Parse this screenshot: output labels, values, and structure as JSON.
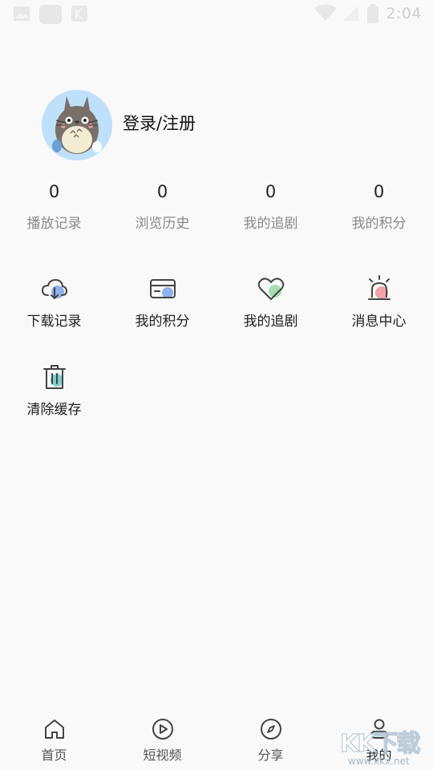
{
  "status_bar": {
    "time": "2:04",
    "icons": [
      "image-icon",
      "notification-icon",
      "app-icon",
      "wifi-icon",
      "signal-icon",
      "battery-icon"
    ]
  },
  "profile": {
    "avatar_icon": "totoro-avatar",
    "login_text": "登录/注册"
  },
  "stats": [
    {
      "value": "0",
      "label": "播放记录"
    },
    {
      "value": "0",
      "label": "浏览历史"
    },
    {
      "value": "0",
      "label": "我的追剧"
    },
    {
      "value": "0",
      "label": "我的积分"
    }
  ],
  "features": [
    {
      "label": "下载记录",
      "icon": "cloud-download-icon",
      "accent": "#8fb0ec"
    },
    {
      "label": "我的积分",
      "icon": "card-icon",
      "accent": "#8fb0ec"
    },
    {
      "label": "我的追剧",
      "icon": "heart-icon",
      "accent": "#a9dcb0"
    },
    {
      "label": "消息中心",
      "icon": "alarm-icon",
      "accent": "#f2a3a8"
    },
    {
      "label": "清除缓存",
      "icon": "trash-icon",
      "accent": "#7ed0cc"
    }
  ],
  "nav": [
    {
      "label": "首页",
      "icon": "home-icon"
    },
    {
      "label": "短视频",
      "icon": "play-icon"
    },
    {
      "label": "分享",
      "icon": "compass-icon"
    },
    {
      "label": "我的",
      "icon": "user-icon"
    }
  ],
  "watermark": {
    "text": "KK下载",
    "url": "www.kkx.net"
  },
  "colors": {
    "background": "#f9f9f9",
    "label_gray": "#8a8a8a",
    "icon_stroke": "#444444"
  }
}
